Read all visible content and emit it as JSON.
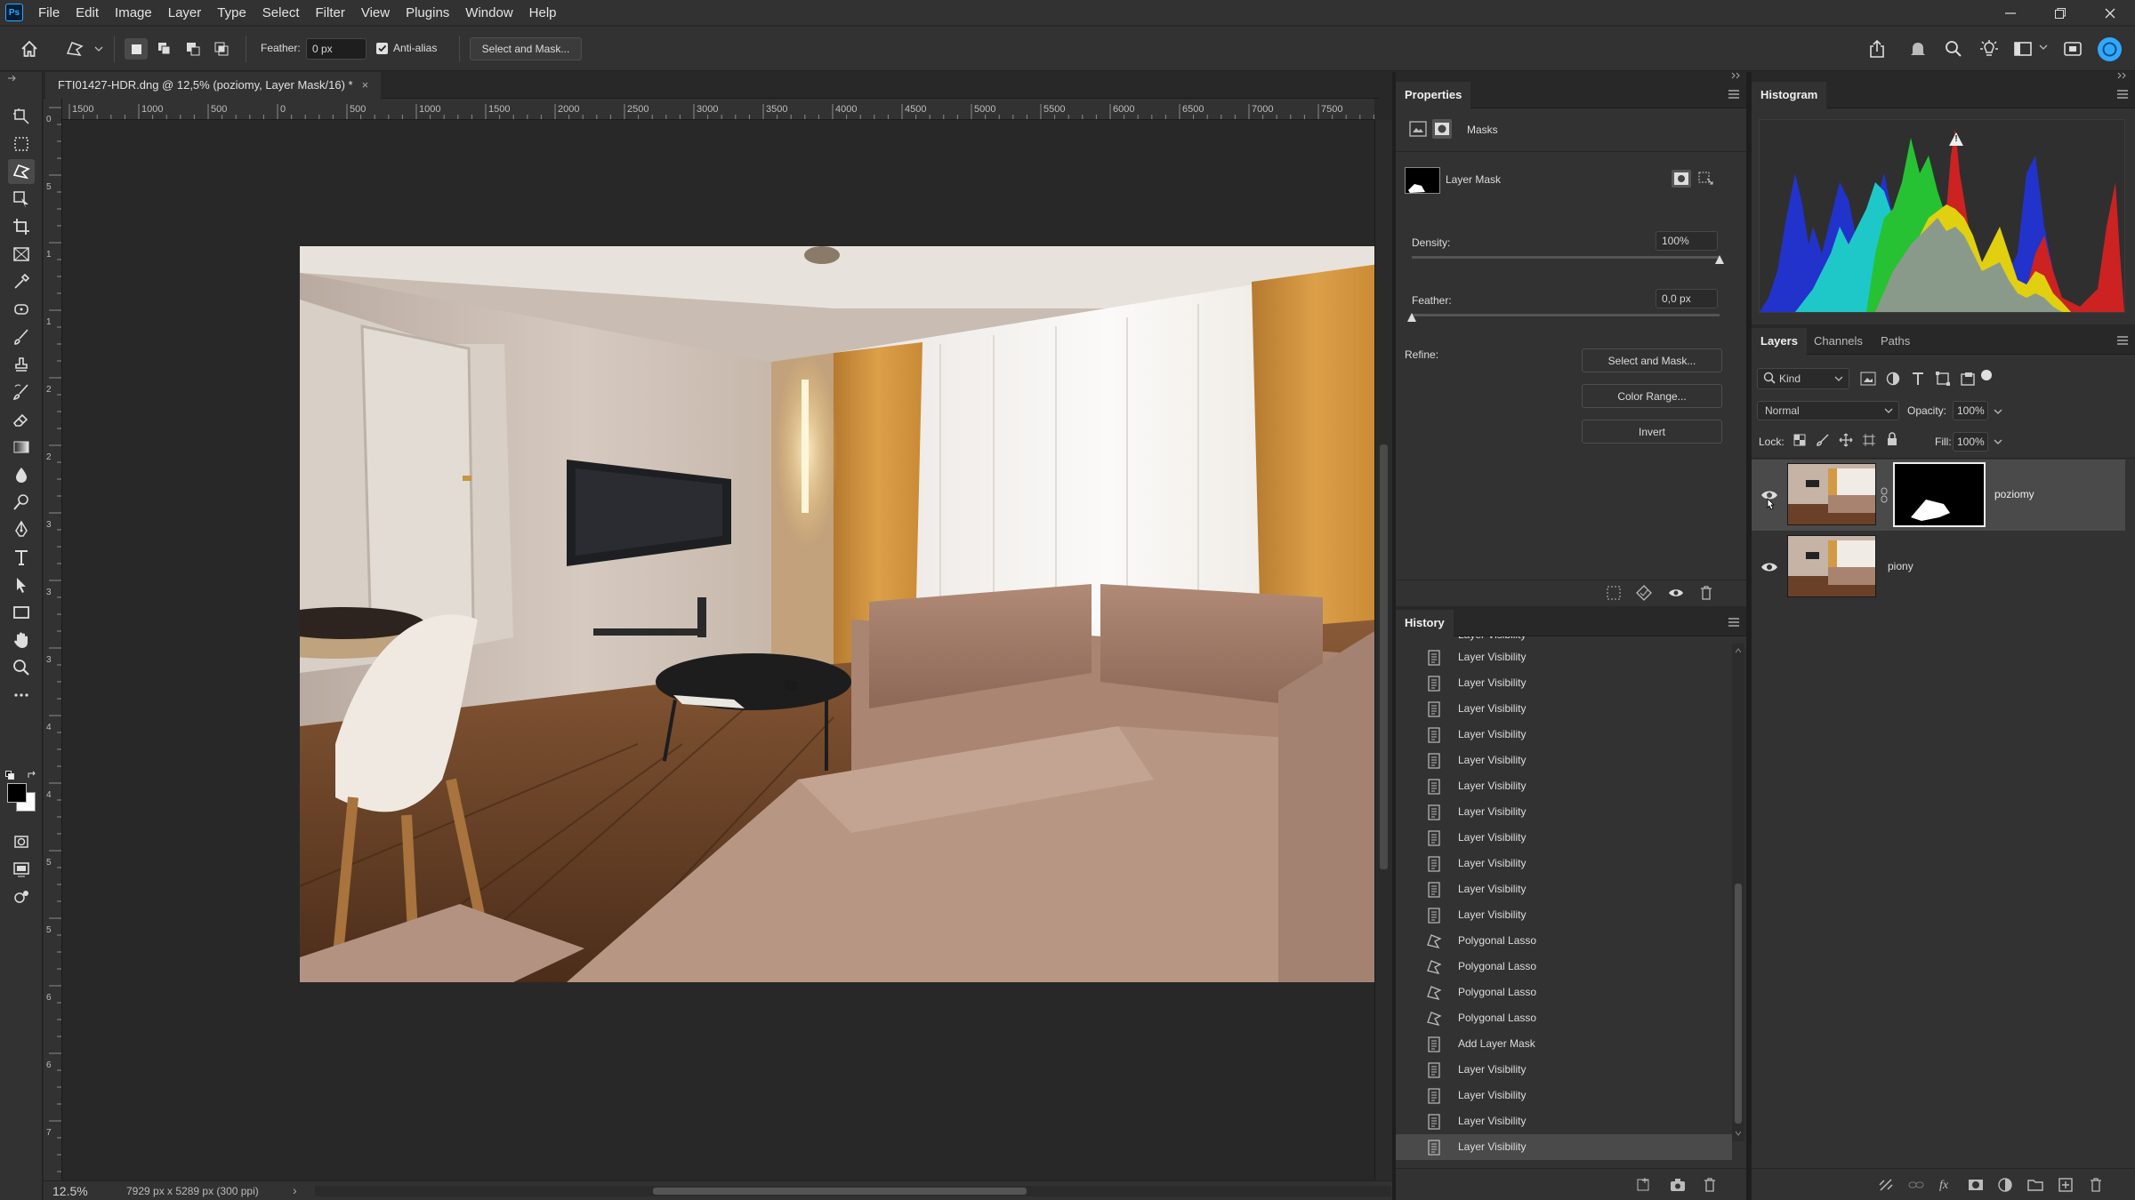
{
  "app": {
    "logo": "Ps"
  },
  "menubar": {
    "items": [
      "File",
      "Edit",
      "Image",
      "Layer",
      "Type",
      "Select",
      "Filter",
      "View",
      "Plugins",
      "Window",
      "Help"
    ]
  },
  "options": {
    "feather_label": "Feather:",
    "feather_value": "0 px",
    "antialias_label": "Anti-alias",
    "antialias_checked": true,
    "select_mask_button": "Select and Mask..."
  },
  "document": {
    "tab_title": "FTI01427-HDR.dng @ 12,5% (poziomy, Layer Mask/16) *",
    "close_glyph": "×",
    "ruler_top": [
      "1500",
      "1000",
      "500",
      "0",
      "500",
      "1000",
      "1500",
      "2000",
      "2500",
      "3000",
      "3500",
      "4000",
      "4500",
      "5000",
      "5500",
      "6000",
      "6500",
      "7000",
      "7500"
    ],
    "ruler_left": [
      "0",
      "5",
      "1",
      "1",
      "2",
      "2",
      "3",
      "3",
      "3",
      "4",
      "4",
      "5",
      "5",
      "6",
      "6",
      "7",
      "7"
    ]
  },
  "status": {
    "zoom": "12.5%",
    "info": "7929 px x 5289 px (300 ppi)",
    "arrow": "›"
  },
  "properties": {
    "title": "Properties",
    "section": "Masks",
    "layer_mask_label": "Layer Mask",
    "density_label": "Density:",
    "density_value": "100%",
    "density_level": 1.0,
    "feather_label": "Feather:",
    "feather_value": "0,0 px",
    "feather_level": 0.0,
    "refine_label": "Refine:",
    "buttons": [
      "Select and Mask...",
      "Color Range...",
      "Invert"
    ]
  },
  "history": {
    "title": "History",
    "items": [
      {
        "label": "Layer Visibility",
        "icon": "document-icon"
      },
      {
        "label": "Layer Visibility",
        "icon": "document-icon"
      },
      {
        "label": "Layer Visibility",
        "icon": "document-icon"
      },
      {
        "label": "Layer Visibility",
        "icon": "document-icon"
      },
      {
        "label": "Layer Visibility",
        "icon": "document-icon"
      },
      {
        "label": "Layer Visibility",
        "icon": "document-icon"
      },
      {
        "label": "Layer Visibility",
        "icon": "document-icon"
      },
      {
        "label": "Layer Visibility",
        "icon": "document-icon"
      },
      {
        "label": "Layer Visibility",
        "icon": "document-icon"
      },
      {
        "label": "Layer Visibility",
        "icon": "document-icon"
      },
      {
        "label": "Layer Visibility",
        "icon": "document-icon"
      },
      {
        "label": "Polygonal Lasso",
        "icon": "polygonal-lasso-icon"
      },
      {
        "label": "Polygonal Lasso",
        "icon": "polygonal-lasso-icon"
      },
      {
        "label": "Polygonal Lasso",
        "icon": "polygonal-lasso-icon"
      },
      {
        "label": "Polygonal Lasso",
        "icon": "polygonal-lasso-icon"
      },
      {
        "label": "Add Layer Mask",
        "icon": "document-icon"
      },
      {
        "label": "Layer Visibility",
        "icon": "document-icon"
      },
      {
        "label": "Layer Visibility",
        "icon": "document-icon"
      },
      {
        "label": "Layer Visibility",
        "icon": "document-icon"
      },
      {
        "label": "Layer Visibility",
        "icon": "document-icon"
      }
    ],
    "partial_item": "Layer Visibility",
    "current_index": 19
  },
  "histogram": {
    "title": "Histogram",
    "warning_glyph": "!"
  },
  "layers": {
    "tabs": [
      "Layers",
      "Channels",
      "Paths"
    ],
    "kind_label": "Kind",
    "blend_mode": "Normal",
    "opacity_label": "Opacity:",
    "opacity_value": "100%",
    "lock_label": "Lock:",
    "fill_label": "Fill:",
    "fill_value": "100%",
    "list": [
      {
        "name": "poziomy",
        "visible": true,
        "has_mask": true,
        "selected": true
      },
      {
        "name": "piony",
        "visible": true,
        "has_mask": false,
        "selected": false
      }
    ]
  },
  "colors": {
    "bg_dark": "#282828",
    "panel": "#323232",
    "highlight": "#4a4a4a",
    "accent": "#31a8ff"
  }
}
